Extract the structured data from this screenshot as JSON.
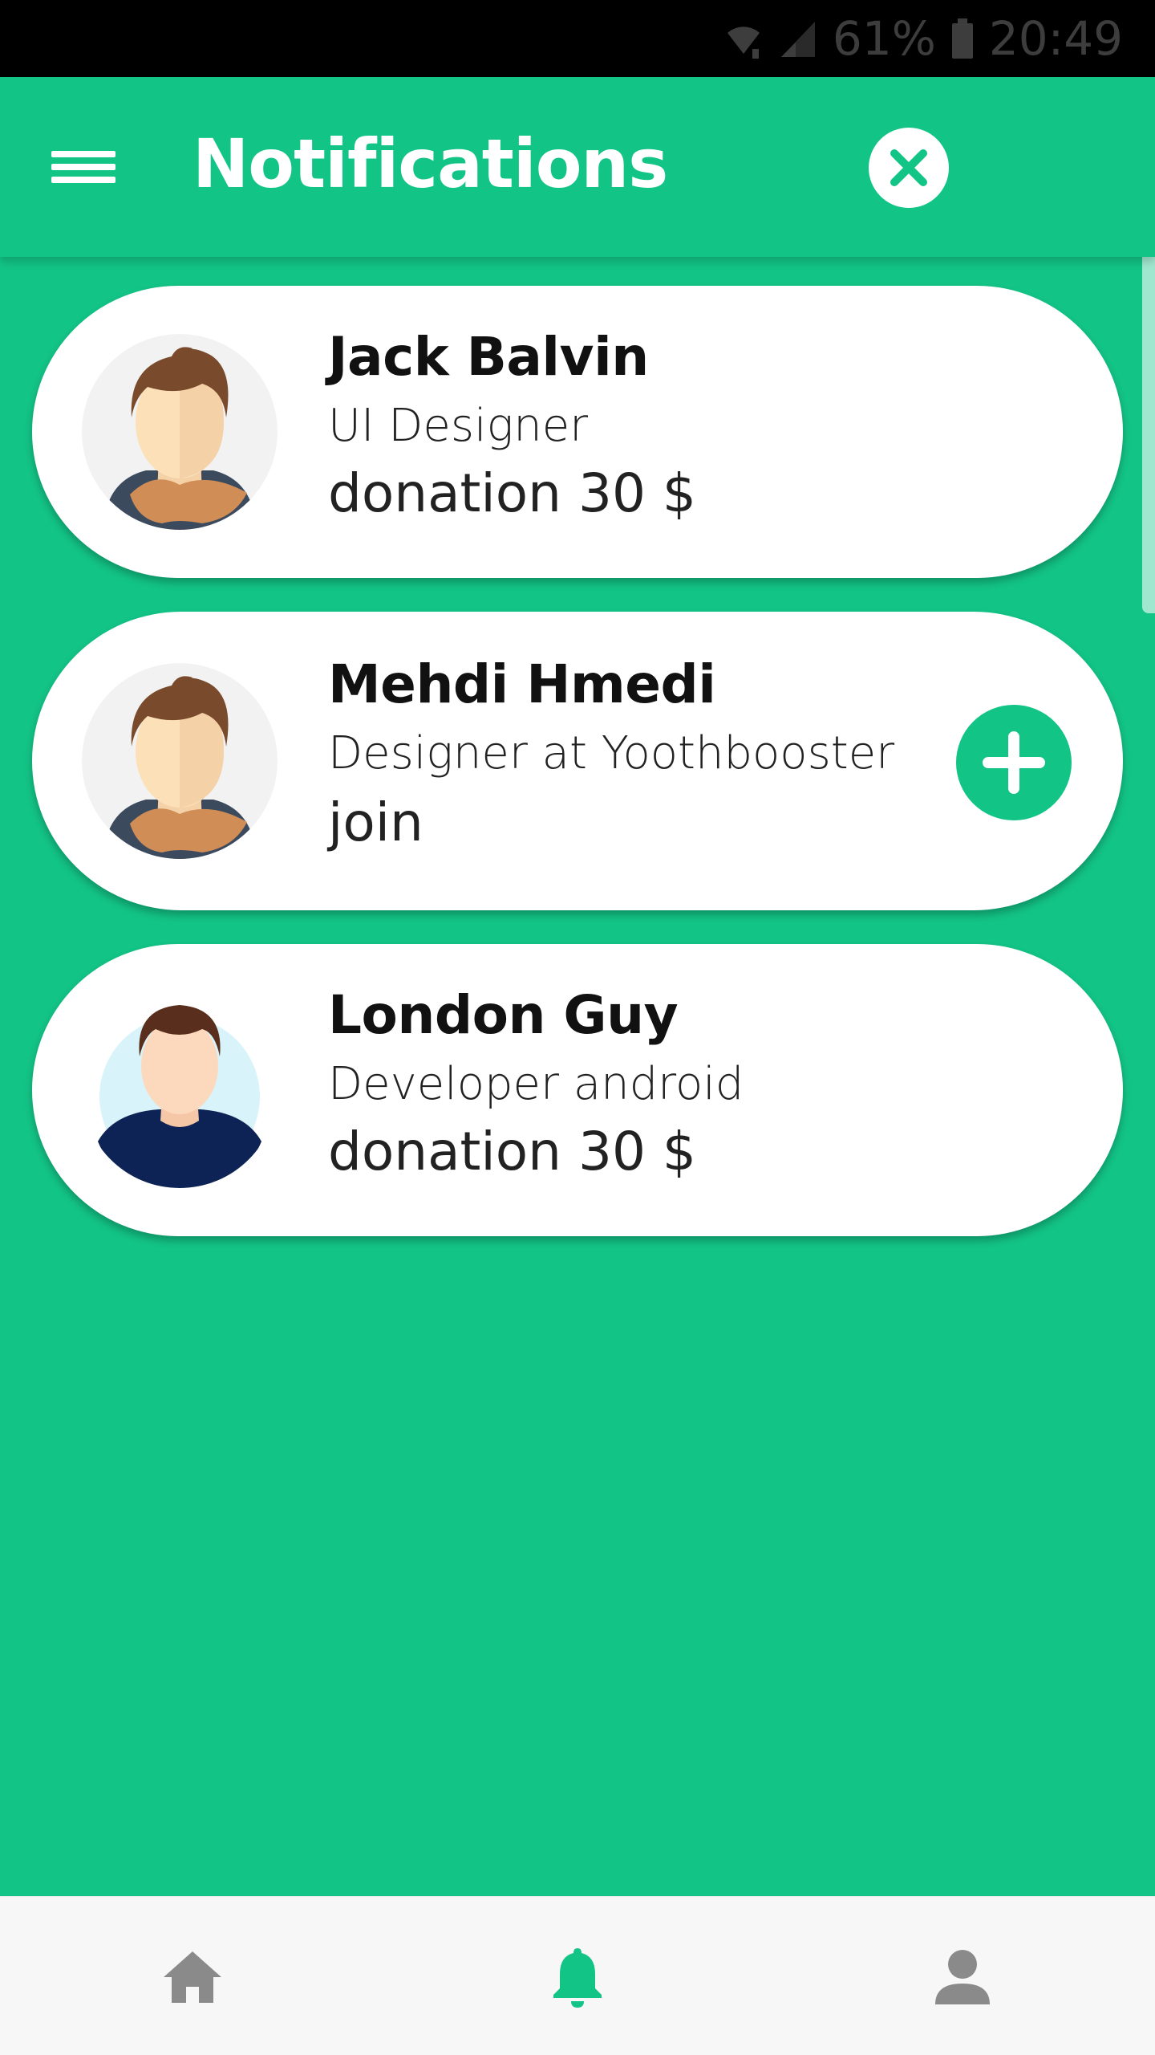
{
  "status_bar": {
    "battery": "61%",
    "time": "20:49",
    "icons": [
      "wifi-icon",
      "signal-icon",
      "battery-icon"
    ]
  },
  "app_bar": {
    "title": "Notifications",
    "menu_icon": "hamburger-menu-icon",
    "close_icon": "close-icon"
  },
  "notifications": [
    {
      "name": "Jack Balvin",
      "role": "UI Designer",
      "detail": "donation 30 $",
      "avatar": "avatar-man-scarf"
    },
    {
      "name": "Mehdi Hmedi",
      "role": "Designer at Yoothbooster",
      "detail": "join",
      "avatar": "avatar-man-scarf",
      "action_icon": "plus-icon"
    },
    {
      "name": "London Guy",
      "role": "Developer android",
      "detail": "donation 30 $",
      "avatar": "avatar-man-navy-shirt"
    }
  ],
  "bottom_nav": {
    "items": [
      {
        "icon": "home-icon",
        "active": false
      },
      {
        "icon": "bell-icon",
        "active": true
      },
      {
        "icon": "profile-icon",
        "active": false
      }
    ]
  },
  "colors": {
    "primary": "#13c487",
    "card": "#ffffff",
    "nav_inactive": "#8a8a8a",
    "nav_active": "#13c487"
  }
}
